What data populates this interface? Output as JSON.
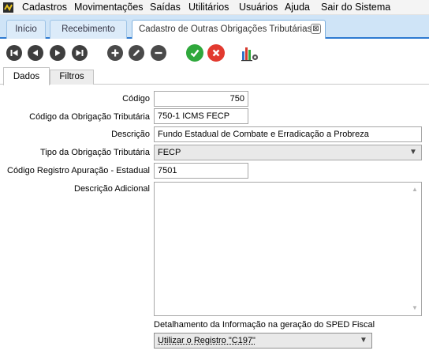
{
  "menu": {
    "items": [
      {
        "label": "Cadastros"
      },
      {
        "label": "Movimentações"
      },
      {
        "label": "Saídas"
      },
      {
        "label": "Utilitários"
      },
      {
        "label": "Usuários"
      },
      {
        "label": "Ajuda"
      },
      {
        "label": "Sair do Sistema"
      }
    ]
  },
  "tabs": [
    {
      "label": "Início"
    },
    {
      "label": "Recebimento"
    },
    {
      "label": "Cadastro de Outras Obrigações Tributárias",
      "close": "⊠"
    }
  ],
  "toolbar": {
    "icons": [
      "first-icon",
      "previous-icon",
      "next-icon",
      "last-icon",
      "add-icon",
      "edit-icon",
      "remove-icon",
      "confirm-icon",
      "cancel-icon",
      "report-icon"
    ]
  },
  "subtabs": [
    {
      "label": "Dados"
    },
    {
      "label": "Filtros"
    }
  ],
  "form": {
    "codigo_label": "Código",
    "codigo_value": "750",
    "codigo_obrigacao_label": "Código da Obrigação Tributária",
    "codigo_obrigacao_value": "750-1 ICMS FECP",
    "descricao_label": "Descrição",
    "descricao_value": "Fundo Estadual de Combate e Erradicação a Probreza",
    "tipo_label": "Tipo da Obrigação Tributária",
    "tipo_value": "FECP",
    "registro_label": "Código Registro Apuração - Estadual",
    "registro_value": "7501",
    "descricao_adicional_label": "Descrição Adicional",
    "descricao_adicional_value": "",
    "detalhamento_label": "Detalhamento da Informação na geração do SPED  Fiscal",
    "detalhamento_value": "Utilizar o Registro \"C197\""
  },
  "colors": {
    "tabstrip_bg": "#cfe4f7",
    "tab_border": "#2e7ad1",
    "confirm": "#2fa83c",
    "cancel": "#e23a2f"
  }
}
